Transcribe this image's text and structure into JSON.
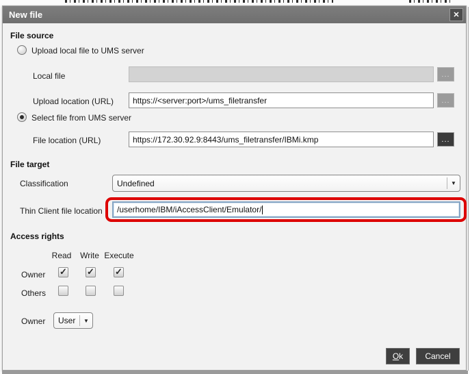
{
  "dialog": {
    "title": "New file",
    "close_icon": "✕",
    "file_source": {
      "heading": "File source",
      "upload_radio_label": "Upload local file to UMS server",
      "upload_radio_selected": false,
      "local_file_label": "Local file",
      "local_file_value": "",
      "local_file_browse": "...",
      "upload_location_label": "Upload location (URL)",
      "upload_location_value": "https://<server:port>/ums_filetransfer",
      "upload_location_browse": "...",
      "select_radio_label": "Select file from UMS server",
      "select_radio_selected": true,
      "file_location_label": "File location (URL)",
      "file_location_value": "https://172.30.92.9:8443/ums_filetransfer/IBMi.kmp",
      "file_location_browse": "..."
    },
    "file_target": {
      "heading": "File target",
      "classification_label": "Classification",
      "classification_value": "Undefined",
      "dropdown_arrow": "▼",
      "thin_client_label": "Thin Client file location",
      "thin_client_value": "/userhome/IBM/iAccessClient/Emulator/"
    },
    "access_rights": {
      "heading": "Access rights",
      "columns": [
        "Read",
        "Write",
        "Execute"
      ],
      "rows": [
        {
          "label": "Owner",
          "read": true,
          "write": true,
          "execute": true
        },
        {
          "label": "Others",
          "read": false,
          "write": false,
          "execute": false
        }
      ],
      "owner_label": "Owner",
      "owner_value": "User"
    },
    "buttons": {
      "ok_label": "Ok",
      "cancel_label": "Cancel"
    }
  },
  "annotation": {
    "highlight_color": "#dd0000"
  },
  "colors": {
    "titlebar": "#747474",
    "dialog_bg": "#f2f2f2",
    "button_dark": "#3f3f3f",
    "focus_border": "#86a5c4"
  }
}
